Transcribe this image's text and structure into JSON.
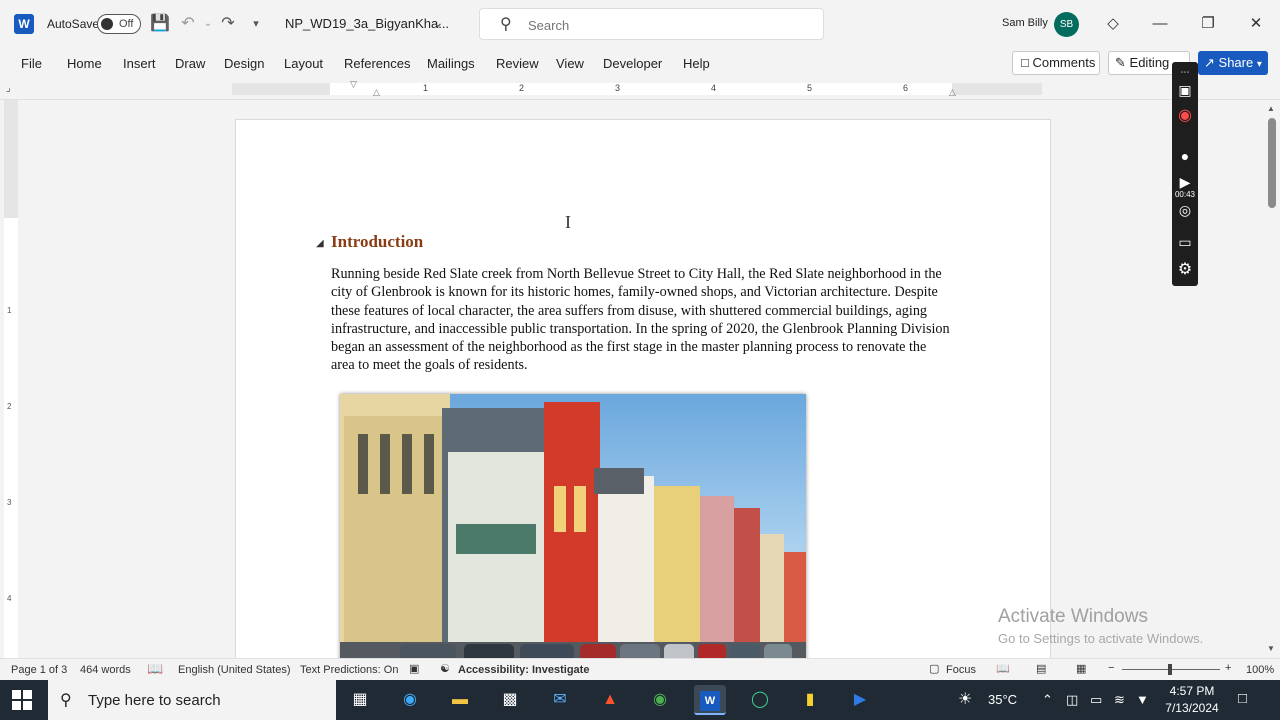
{
  "titlebar": {
    "autosave_label": "AutoSave",
    "autosave_state": "Off",
    "doc_title": "NP_WD19_3a_BigyanKha...",
    "search_placeholder": "Search",
    "user_name": "Sam Billy",
    "user_initials": "SB"
  },
  "menu": [
    "File",
    "Home",
    "Insert",
    "Draw",
    "Design",
    "Layout",
    "References",
    "Mailings",
    "Review",
    "View",
    "Developer",
    "Help"
  ],
  "actions": {
    "comments": "Comments",
    "editing": "Editing",
    "share": "Share"
  },
  "ruler": {
    "numbers": [
      "1",
      "2",
      "3",
      "4",
      "5",
      "6"
    ],
    "vertical_numbers": [
      "1",
      "2",
      "3",
      "4"
    ]
  },
  "document": {
    "heading": "Introduction",
    "paragraph": "Running beside Red Slate creek from North Bellevue Street to City Hall, the Red Slate neighborhood in the city of Glenbrook is known for its historic homes, family-owned shops, and Victorian architecture. Despite these features of local character, the area suffers from disuse, with shuttered commercial buildings, aging infrastructure, and inaccessible public transportation. In the spring of 2020, the Glenbrook Planning Division began an assessment of the neighborhood as the first stage in the master planning process to renovate the area to meet the goals of residents."
  },
  "recorder": {
    "time": "00:43"
  },
  "watermark": {
    "title": "Activate Windows",
    "subtitle": "Go to Settings to activate Windows."
  },
  "statusbar": {
    "page": "Page 1 of 3",
    "words": "464 words",
    "language": "English (United States)",
    "predictions": "Text Predictions: On",
    "accessibility": "Accessibility: Investigate",
    "focus": "Focus",
    "zoom": "100%"
  },
  "taskbar": {
    "search_placeholder": "Type here to search",
    "temperature": "35°C",
    "time": "4:57 PM",
    "date": "7/13/2024"
  },
  "colors": {
    "word_blue": "#185abd",
    "heading": "#8a3d14",
    "avatar": "#036c5f",
    "taskbar": "#1f2a35"
  }
}
